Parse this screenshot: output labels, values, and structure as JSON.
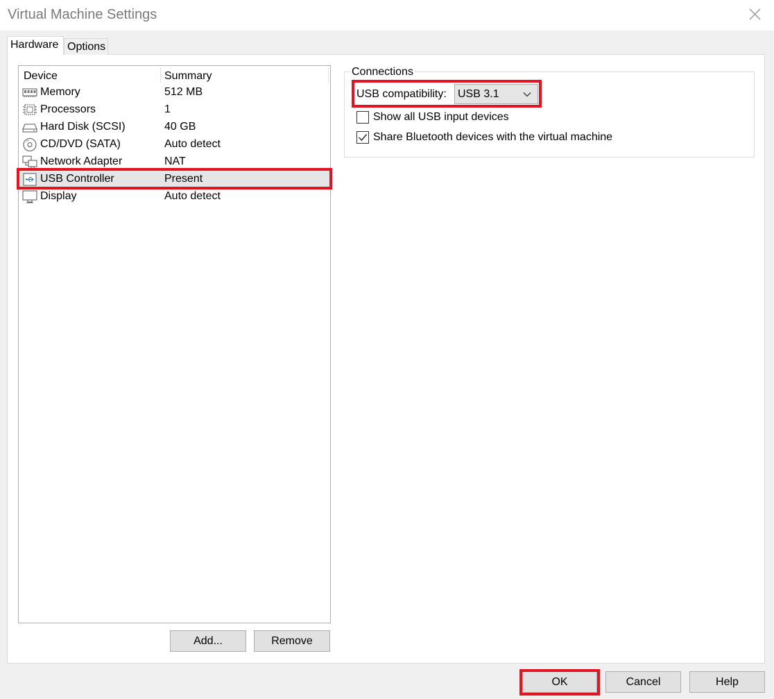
{
  "window": {
    "title": "Virtual Machine Settings"
  },
  "tabs": [
    {
      "label": "Hardware",
      "active": true
    },
    {
      "label": "Options",
      "active": false
    }
  ],
  "device_list": {
    "columns": [
      "Device",
      "Summary"
    ],
    "rows": [
      {
        "icon": "memory-icon",
        "name": "Memory",
        "summary": "512 MB"
      },
      {
        "icon": "processor-icon",
        "name": "Processors",
        "summary": "1"
      },
      {
        "icon": "hard-disk-icon",
        "name": "Hard Disk (SCSI)",
        "summary": "40 GB"
      },
      {
        "icon": "cd-dvd-icon",
        "name": "CD/DVD (SATA)",
        "summary": "Auto detect"
      },
      {
        "icon": "network-adapter-icon",
        "name": "Network Adapter",
        "summary": "NAT"
      },
      {
        "icon": "usb-icon",
        "name": "USB Controller",
        "summary": "Present",
        "selected": true
      },
      {
        "icon": "display-icon",
        "name": "Display",
        "summary": "Auto detect"
      }
    ]
  },
  "list_buttons": {
    "add": "Add...",
    "remove": "Remove"
  },
  "connections": {
    "group_label": "Connections",
    "usb_compat_label": "USB compatibility:",
    "usb_compat_value": "USB 3.1",
    "show_all_usb": {
      "label": "Show all USB input devices",
      "checked": false
    },
    "share_bluetooth": {
      "label": "Share Bluetooth devices with the virtual machine",
      "checked": true
    }
  },
  "footer": {
    "ok": "OK",
    "cancel": "Cancel",
    "help": "Help"
  },
  "colors": {
    "highlight": "#e3141f",
    "selection": "#e5e5e5"
  }
}
